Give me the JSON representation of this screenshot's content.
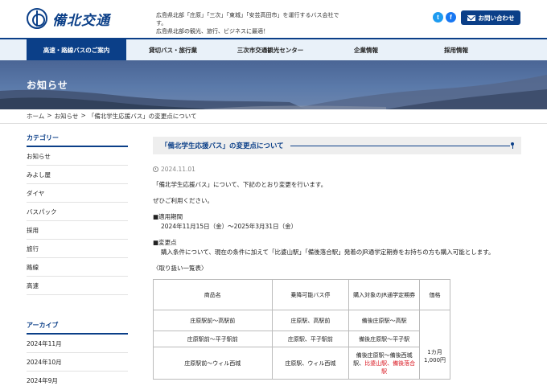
{
  "header": {
    "logo_text": "備北交通",
    "tagline_line1": "広島県北部「庄原」「三次」「東城」「安芸高田市」を運行するバス会社です。",
    "tagline_line2": "広島県北部の観光、旅行、ビジネスに最適！",
    "social": {
      "twitter": "t",
      "facebook": "f"
    },
    "contact_label": "お問い合わせ"
  },
  "nav": {
    "items": [
      {
        "label": "高速・路線バスのご案内",
        "active": true
      },
      {
        "label": "貸切バス・旅行業"
      },
      {
        "label": "三次市交通観光センター"
      },
      {
        "label": "企業情報"
      },
      {
        "label": "採用情報"
      }
    ]
  },
  "hero": {
    "title": "お知らせ"
  },
  "breadcrumb": {
    "home": "ホーム",
    "sep": ">",
    "news": "お知らせ",
    "current": "「備北学生応援バス」の変更点について"
  },
  "sidebar": {
    "category_heading": "カテゴリー",
    "categories": [
      "お知らせ",
      "みよし屋",
      "ダイヤ",
      "バスパック",
      "採用",
      "旅行",
      "路線",
      "高速"
    ],
    "archive_heading": "アーカイブ",
    "archives": [
      "2024年11月",
      "2024年10月",
      "2024年9月"
    ]
  },
  "post": {
    "title": "「備北学生応援バス」の変更点について",
    "date": "2024.11.01",
    "intro": "「備北学生応援バス」について、下記のとおり変更を行います。",
    "please_use": "ぜひご利用ください。",
    "period_heading": "■適用期間",
    "period_value": "2024年11月15日（金）～2025年3月31日（金）",
    "change_heading": "■変更点",
    "change_value": "購入条件について、現在の条件に加えて「比婆山駅」「備後落合駅」発着のJR通学定期券をお持ちの方も購入可能とします。",
    "list_label": "〈取り扱い一覧表〉"
  },
  "table": {
    "headers": [
      "商品名",
      "乗降可能バス停",
      "購入対象のJR通学定期券",
      "価格"
    ],
    "rows": [
      {
        "product": "庄原駅前～高駅前",
        "stops": "庄原駅、高駅前",
        "jr": "備後庄原駅～高駅"
      },
      {
        "product": "庄原駅前～平子駅前",
        "stops": "庄原駅、平子駅前",
        "jr": "備後庄原駅～平子駅"
      },
      {
        "product": "庄原駅前～ウィル西城",
        "stops": "庄原駅、ウィル西城",
        "jr_prefix": "備後庄原駅～備後西城駅、",
        "jr_red": "比婆山駅、備後落合駅"
      }
    ],
    "price_line1": "1カ月",
    "price_line2": "1,000円"
  }
}
